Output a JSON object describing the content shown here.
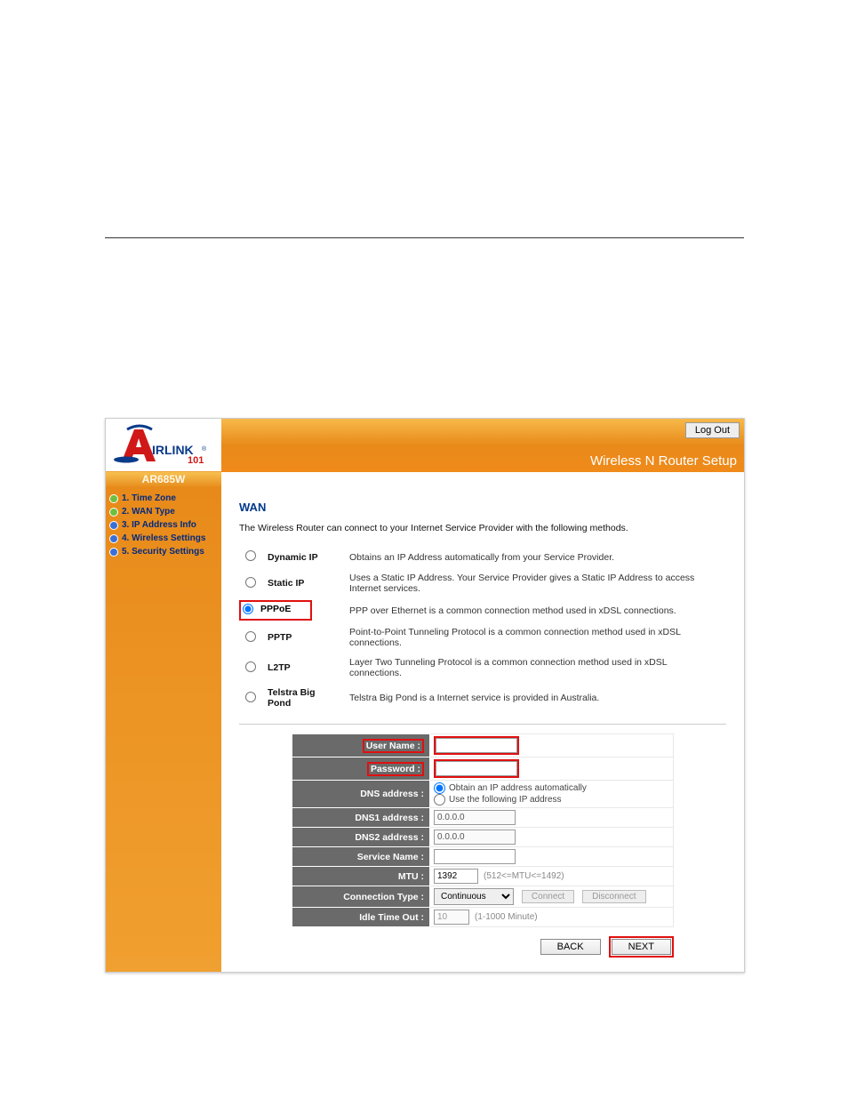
{
  "header": {
    "logout": "Log Out",
    "title": "Wireless N Router Setup",
    "model": "AR685W"
  },
  "sidebar": [
    "1. Time Zone",
    "2. WAN Type",
    "3. IP Address Info",
    "4. Wireless Settings",
    "5. Security Settings"
  ],
  "main": {
    "title": "WAN",
    "intro": "The Wireless Router can connect to your Internet Service Provider with the following methods.",
    "options": [
      {
        "label": "Dynamic IP",
        "desc": "Obtains an IP Address automatically from your Service Provider."
      },
      {
        "label": "Static IP",
        "desc": "Uses a Static IP Address. Your Service Provider gives a Static IP Address to access Internet services."
      },
      {
        "label": "PPPoE",
        "desc": "PPP over Ethernet is a common connection method used in xDSL connections."
      },
      {
        "label": "PPTP",
        "desc": "Point-to-Point Tunneling Protocol is a common connection method used in xDSL connections."
      },
      {
        "label": "L2TP",
        "desc": "Layer Two Tunneling Protocol is a common connection method used in xDSL connections."
      },
      {
        "label": "Telstra Big Pond",
        "desc": "Telstra Big Pond is a Internet service is provided in Australia."
      }
    ]
  },
  "form": {
    "username": {
      "label": "User Name :",
      "value": ""
    },
    "password": {
      "label": "Password :",
      "value": ""
    },
    "dns": {
      "label": "DNS address :",
      "opt1": "Obtain an IP address automatically",
      "opt2": "Use the following IP address"
    },
    "dns1": {
      "label": "DNS1 address :",
      "value": "0.0.0.0"
    },
    "dns2": {
      "label": "DNS2 address :",
      "value": "0.0.0.0"
    },
    "service": {
      "label": "Service Name :",
      "value": ""
    },
    "mtu": {
      "label": "MTU :",
      "value": "1392",
      "hint": "(512<=MTU<=1492)"
    },
    "conn": {
      "label": "Connection Type :",
      "value": "Continuous",
      "btn1": "Connect",
      "btn2": "Disconnect"
    },
    "idle": {
      "label": "Idle Time Out :",
      "value": "10",
      "hint": "(1-1000 Minute)"
    }
  },
  "nav": {
    "back": "BACK",
    "next": "NEXT"
  }
}
